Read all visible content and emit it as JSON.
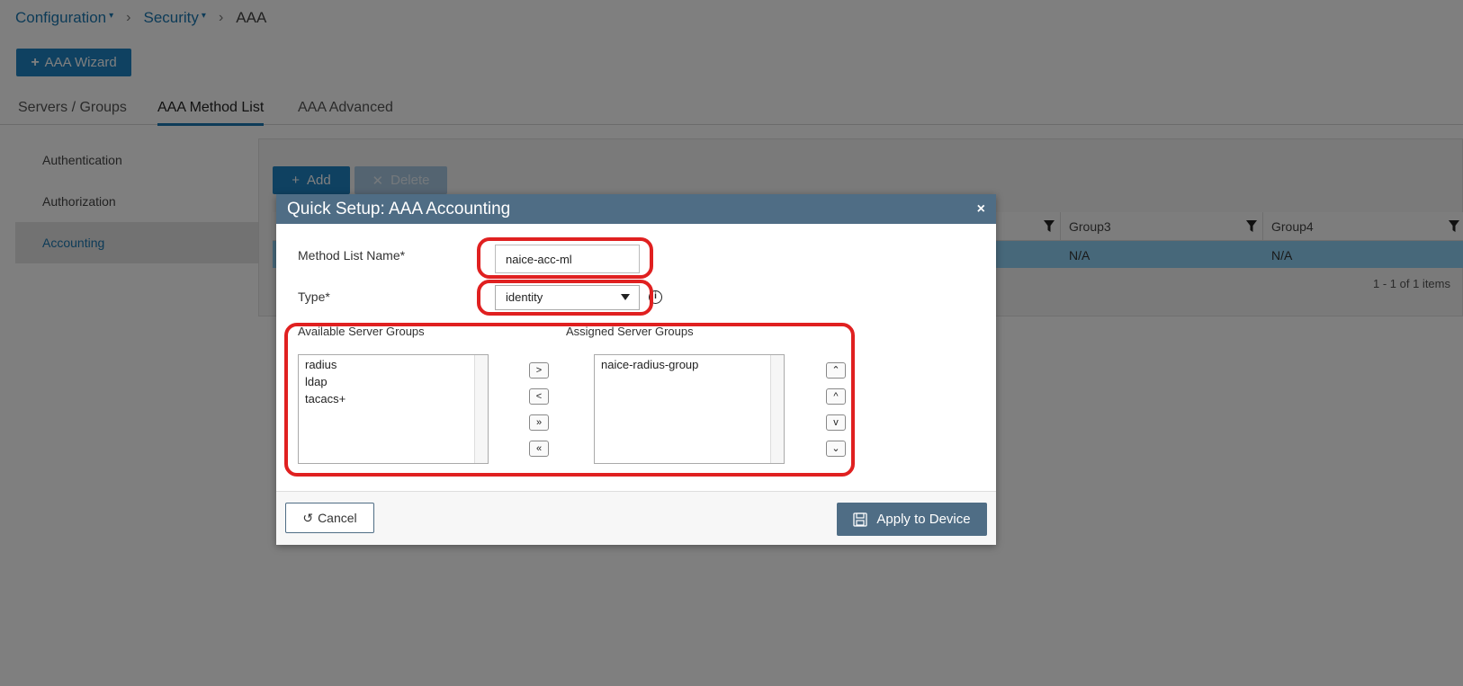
{
  "breadcrumb": {
    "item1": "Configuration",
    "item2": "Security",
    "current": "AAA"
  },
  "toolbar": {
    "wizard_label": "AAA Wizard"
  },
  "tabs": {
    "servers": "Servers / Groups",
    "method_list": "AAA Method List",
    "advanced": "AAA Advanced"
  },
  "sidebar": {
    "items": [
      "Authentication",
      "Authorization",
      "Accounting"
    ]
  },
  "panel": {
    "add_label": "Add",
    "delete_label": "Delete",
    "columns": [
      "Group3",
      "Group4"
    ],
    "row": [
      "N/A",
      "N/A"
    ],
    "pager": "1 - 1 of 1 items"
  },
  "modal": {
    "title": "Quick Setup: AAA Accounting",
    "close": "×",
    "method_list_label": "Method List Name*",
    "method_list_value": "naice-acc-ml",
    "type_label": "Type*",
    "type_value": "identity",
    "available_label": "Available Server Groups",
    "assigned_label": "Assigned Server Groups",
    "available_items": [
      "radius",
      "ldap",
      "tacacs+"
    ],
    "assigned_items": [
      "naice-radius-group"
    ],
    "cancel_label": "Cancel",
    "apply_label": "Apply to Device"
  },
  "colors": {
    "primary": "#1f83c2",
    "modal_header": "#4f6d85",
    "annotation": "#e02020"
  }
}
